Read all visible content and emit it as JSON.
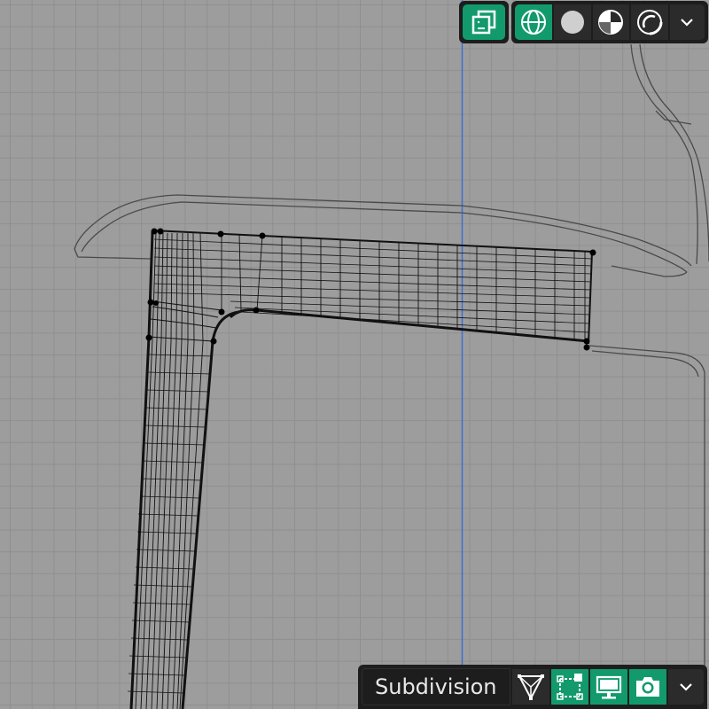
{
  "viewport": {
    "accent_color": "#129a6d",
    "axis_color": "#3f6fd0",
    "grid_color": "#8f8f8f",
    "background_color": "#9d9d9d"
  },
  "overlay_toggle": {
    "icon": "overlay-icon",
    "active": true
  },
  "shading_modes": {
    "items": [
      {
        "icon": "wireframe-shading-icon",
        "active": true
      },
      {
        "icon": "solid-shading-icon",
        "active": false
      },
      {
        "icon": "material-preview-shading-icon",
        "active": false
      },
      {
        "icon": "rendered-shading-icon",
        "active": false
      }
    ],
    "dropdown_icon": "chevron-down-icon"
  },
  "modifier": {
    "name": "Subdivision",
    "buttons": [
      {
        "icon": "edit-mode-display-icon",
        "active": false
      },
      {
        "icon": "on-cage-icon",
        "active": true
      },
      {
        "icon": "viewport-display-icon",
        "active": true
      },
      {
        "icon": "render-camera-icon",
        "active": true
      }
    ],
    "dropdown_icon": "chevron-down-icon"
  }
}
